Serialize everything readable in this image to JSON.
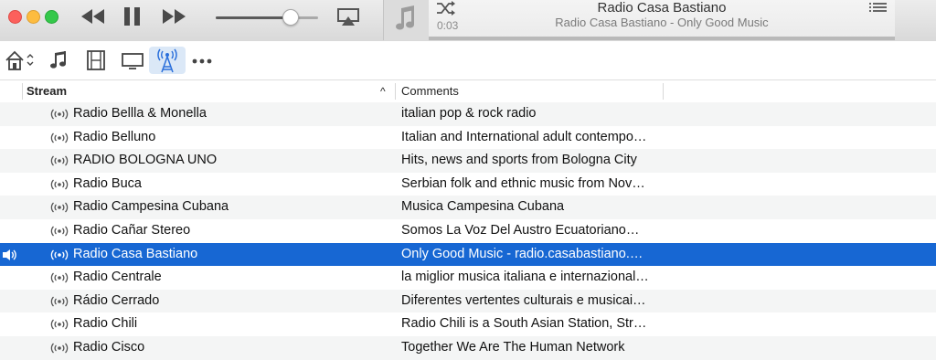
{
  "player": {
    "elapsed": "0:03",
    "now_playing_title": "Radio Casa Bastiano",
    "now_playing_subtitle": "Radio Casa Bastiano - Only Good Music",
    "volume_percent": 72
  },
  "media_kinds": [
    {
      "name": "home-dropdown"
    },
    {
      "name": "music"
    },
    {
      "name": "movies"
    },
    {
      "name": "tv-shows"
    },
    {
      "name": "internet-radio",
      "selected": true
    },
    {
      "name": "more"
    }
  ],
  "table": {
    "col_stream": "Stream",
    "col_comments": "Comments",
    "sort_indicator": "^",
    "rows": [
      {
        "stream": "Radio Bellla & Monella",
        "comments": "italian pop & rock radio"
      },
      {
        "stream": "Radio Belluno",
        "comments": "Italian and International adult contempo…"
      },
      {
        "stream": "RADIO BOLOGNA UNO",
        "comments": "Hits, news and sports from Bologna City"
      },
      {
        "stream": "Radio Buca",
        "comments": "Serbian folk and ethnic music from Nov…"
      },
      {
        "stream": "Radio Campesina Cubana",
        "comments": "Musica Campesina Cubana"
      },
      {
        "stream": "Radio Cañar Stereo",
        "comments": "Somos La Voz Del Austro Ecuatoriano…"
      },
      {
        "stream": "Radio Casa Bastiano",
        "comments": "Only Good Music - radio.casabastiano.…",
        "selected": true,
        "playing": true
      },
      {
        "stream": "Radio Centrale",
        "comments": "la miglior musica italiana e internazional…"
      },
      {
        "stream": "Rádio Cerrado",
        "comments": "Diferentes vertentes culturais e musicai…"
      },
      {
        "stream": "Radio Chili",
        "comments": "Radio Chili is a South Asian Station, Str…"
      },
      {
        "stream": "Radio Cisco",
        "comments": "Together We Are The Human Network"
      }
    ]
  },
  "colors": {
    "selection": "#1767d3",
    "kind_selected_bg": "#dbe8f7",
    "kind_selected_icon": "#2a6fdb"
  }
}
